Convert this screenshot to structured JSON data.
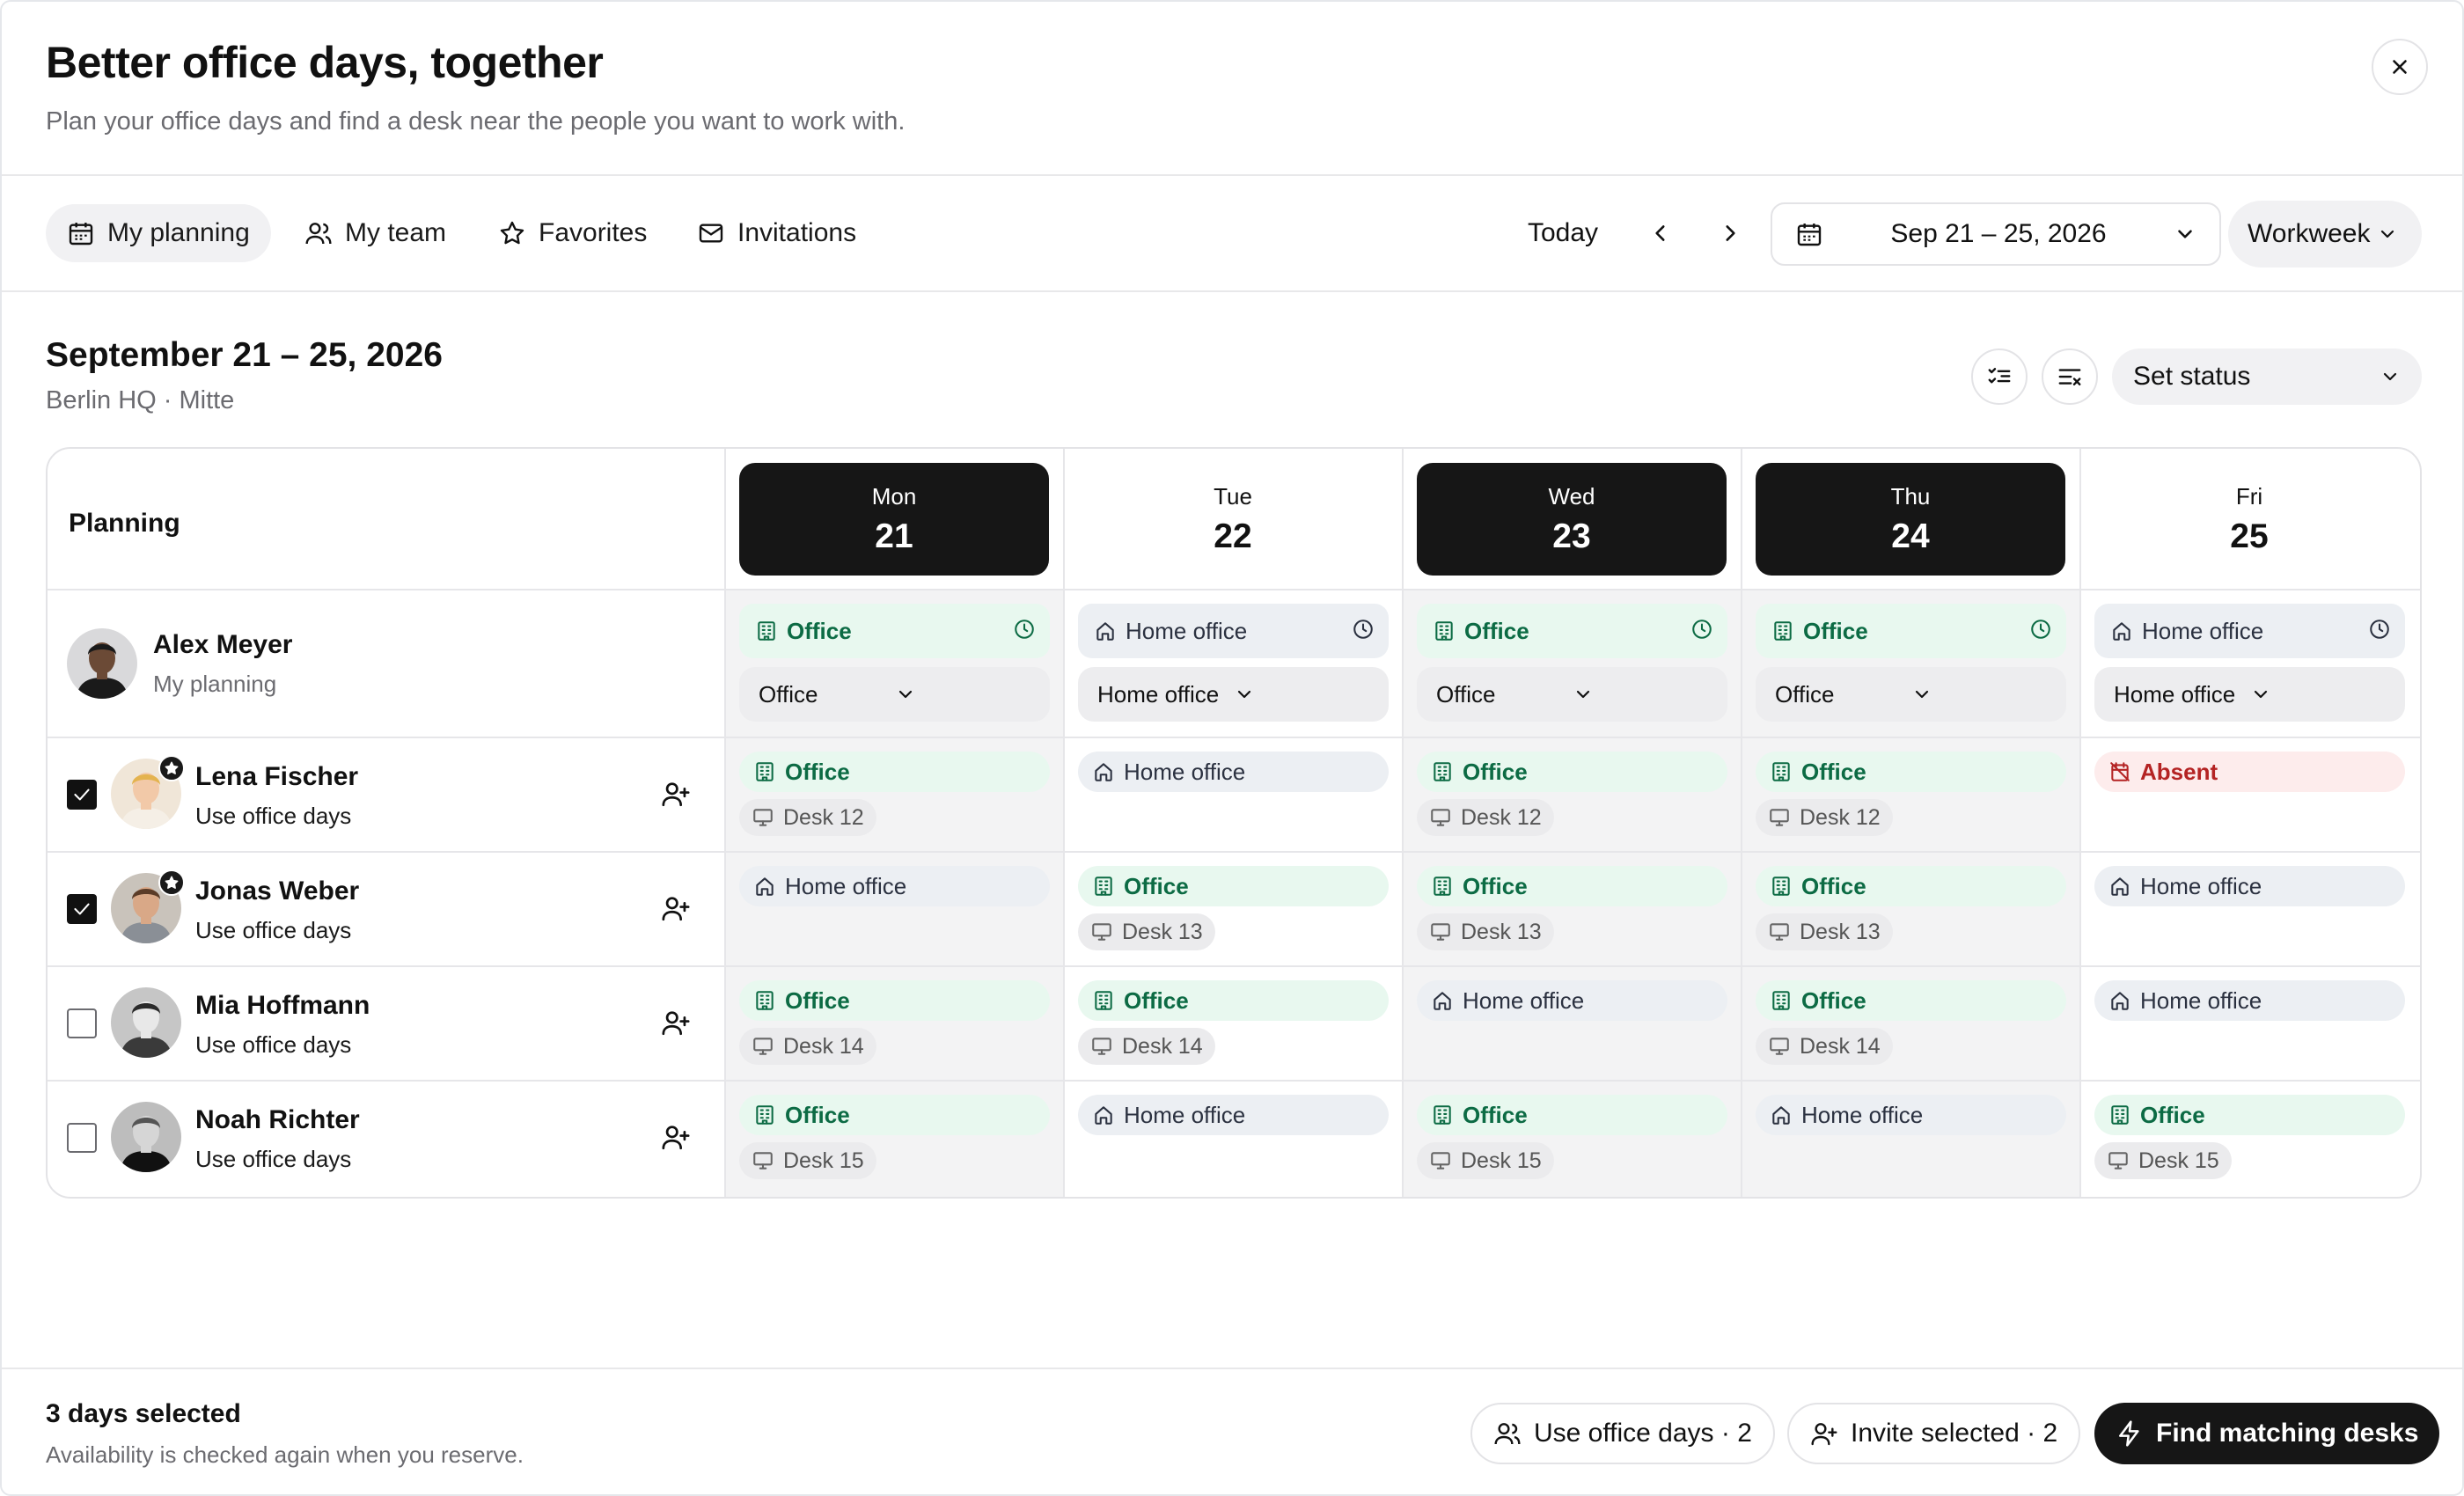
{
  "header": {
    "title": "Better office days, together",
    "subtitle": "Plan your office days and find a desk near the people you want to work with."
  },
  "toolbar": {
    "tabs": [
      {
        "label": "My planning",
        "icon": "calendar-icon",
        "active": true
      },
      {
        "label": "My team",
        "icon": "users-icon",
        "active": false
      },
      {
        "label": "Favorites",
        "icon": "star-icon",
        "active": false
      },
      {
        "label": "Invitations",
        "icon": "mail-icon",
        "active": false
      }
    ],
    "today_label": "Today",
    "date_range": "Sep 21 – 25, 2026",
    "view": "Workweek"
  },
  "week": {
    "title": "September 21 – 25, 2026",
    "location": "Berlin HQ · Mitte",
    "status_select": "Set status"
  },
  "grid": {
    "planning_label": "Planning",
    "days": [
      {
        "dow": "Mon",
        "num": "21",
        "selected": true
      },
      {
        "dow": "Tue",
        "num": "22",
        "selected": false
      },
      {
        "dow": "Wed",
        "num": "23",
        "selected": true
      },
      {
        "dow": "Thu",
        "num": "24",
        "selected": true
      },
      {
        "dow": "Fri",
        "num": "25",
        "selected": false
      }
    ],
    "me": {
      "name": "Alex Meyer",
      "sub": "My planning",
      "status": [
        "Office",
        "Home office",
        "Office",
        "Office",
        "Home office"
      ],
      "selects": [
        "Office",
        "Home office",
        "Office",
        "Office",
        "Home office"
      ]
    },
    "people": [
      {
        "name": "Lena Fischer",
        "sub": "Use office days",
        "checked": true,
        "favorite": true,
        "status": [
          "Office",
          "Home office",
          "Office",
          "Office",
          "Absent"
        ],
        "desks": [
          "Desk 12",
          "",
          "Desk 12",
          "Desk 12",
          ""
        ]
      },
      {
        "name": "Jonas Weber",
        "sub": "Use office days",
        "checked": true,
        "favorite": true,
        "status": [
          "Home office",
          "Office",
          "Office",
          "Office",
          "Home office"
        ],
        "desks": [
          "",
          "Desk 13",
          "Desk 13",
          "Desk 13",
          ""
        ]
      },
      {
        "name": "Mia Hoffmann",
        "sub": "Use office days",
        "checked": false,
        "favorite": false,
        "status": [
          "Office",
          "Office",
          "Home office",
          "Office",
          "Home office"
        ],
        "desks": [
          "Desk 14",
          "Desk 14",
          "",
          "Desk 14",
          ""
        ]
      },
      {
        "name": "Noah Richter",
        "sub": "Use office days",
        "checked": false,
        "favorite": false,
        "status": [
          "Office",
          "Home office",
          "Office",
          "Home office",
          "Office"
        ],
        "desks": [
          "Desk 15",
          "",
          "Desk 15",
          "",
          "Desk 15"
        ]
      }
    ]
  },
  "footer": {
    "selected_count": "3 days selected",
    "note": "Availability is checked again when you reserve.",
    "use_office_days": "Use office days · 2",
    "invite_selected": "Invite selected · 2",
    "find_desks": "Find matching desks"
  },
  "colors": {
    "office_bg": "#e8f8ef",
    "office_fg": "#0c6b44",
    "home_bg": "#eceff3",
    "absent_bg": "#fdecec",
    "absent_fg": "#b42323",
    "selected_day": "#161616"
  }
}
